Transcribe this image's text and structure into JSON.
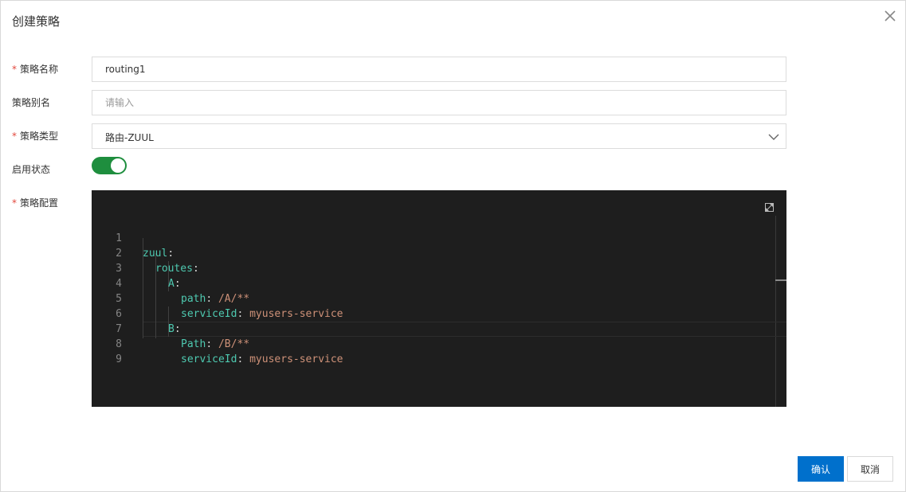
{
  "dialog": {
    "title": "创建策略"
  },
  "form": {
    "name": {
      "required_mark": "*",
      "label": "策略名称",
      "value": "routing1"
    },
    "alias": {
      "label": "策略别名",
      "value": "",
      "placeholder": "请输入"
    },
    "type": {
      "required_mark": "*",
      "label": "策略类型",
      "value": "路由-ZUUL"
    },
    "status": {
      "label": "启用状态",
      "enabled": true
    },
    "config": {
      "required_mark": "*",
      "label": "策略配置"
    }
  },
  "editor": {
    "lines": [
      {
        "no": "1",
        "key": "zuul",
        "colon": ":",
        "value": ""
      },
      {
        "no": "2",
        "key": "routes",
        "colon": ":",
        "value": ""
      },
      {
        "no": "3",
        "key": "A",
        "colon": ":",
        "value": ""
      },
      {
        "no": "4",
        "key": "path",
        "colon": ":",
        "value": " /A/**"
      },
      {
        "no": "5",
        "key": "serviceId",
        "colon": ":",
        "value": " myusers-service"
      },
      {
        "no": "6",
        "key": "B",
        "colon": ":",
        "value": ""
      },
      {
        "no": "7",
        "key": "Path",
        "colon": ":",
        "value": " /B/**"
      },
      {
        "no": "8",
        "key": "serviceId",
        "colon": ":",
        "value": " myusers-service"
      },
      {
        "no": "9",
        "key": "",
        "colon": "",
        "value": ""
      }
    ]
  },
  "footer": {
    "confirm_label": "确认",
    "cancel_label": "取消"
  },
  "colors": {
    "primary": "#0070cc",
    "switch_on": "#1e8e3e",
    "required": "#e2473c",
    "editor_bg": "#1e1e1e",
    "yaml_key": "#4ec9b0",
    "yaml_value": "#ce9178"
  },
  "icons": {
    "close": "close-icon",
    "select_arrow": "chevron-down-icon",
    "editor_fullscreen": "expand-icon"
  }
}
